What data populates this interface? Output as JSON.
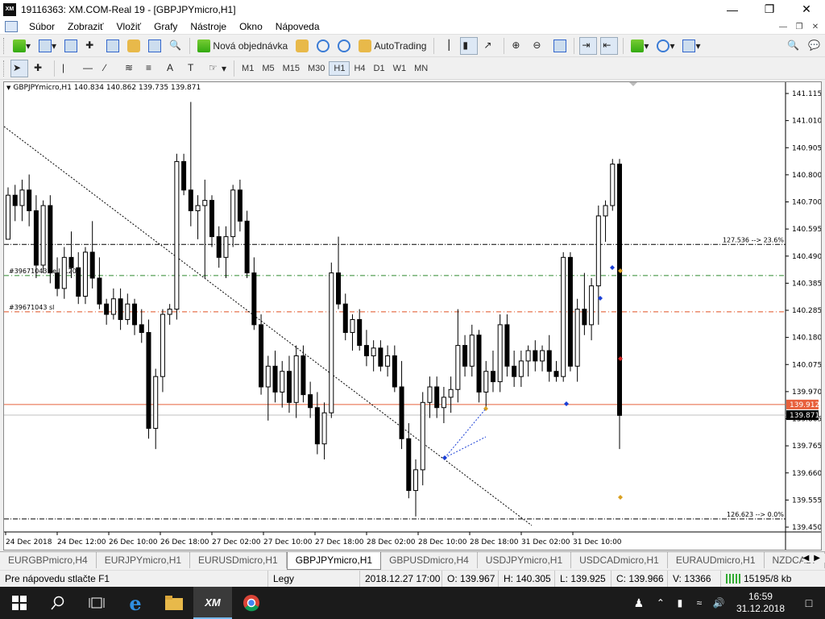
{
  "window": {
    "title": "19116363: XM.COM-Real 19 - [GBPJPYmicro,H1]",
    "app_icon_text": "XM"
  },
  "menu": [
    "Súbor",
    "Zobraziť",
    "Vložiť",
    "Grafy",
    "Nástroje",
    "Okno",
    "Nápoveda"
  ],
  "toolbar1": {
    "new_order": "Nová objednávka",
    "autotrading": "AutoTrading"
  },
  "timeframes": [
    "M1",
    "M5",
    "M15",
    "M30",
    "H1",
    "H4",
    "D1",
    "W1",
    "MN"
  ],
  "active_timeframe": "H1",
  "chart": {
    "header": "GBPJPYmicro,H1  140.834 140.862 139.735 139.871",
    "order_label_sell": "#39671043 sell 0.20",
    "order_label_sl": "#39671043 sl",
    "fib_top": "127.536 --> 23.6%",
    "fib_bottom": "126.623 --> 0.0%",
    "price_label_red": "139.912",
    "price_label_black": "139.871",
    "colors": {
      "bid_line": "#e8603c",
      "sell_line": "#2e8b2e",
      "sl_line": "#e05020",
      "ask_line": "#c0c0c0"
    }
  },
  "chart_data": {
    "type": "candlestick",
    "symbol": "GBPJPYmicro",
    "timeframe": "H1",
    "y_ticks": [
      "141.115",
      "141.010",
      "140.905",
      "140.800",
      "140.700",
      "140.595",
      "140.490",
      "140.385",
      "140.285",
      "140.180",
      "140.075",
      "139.970",
      "139.865",
      "139.765",
      "139.660",
      "139.555",
      "139.450"
    ],
    "x_ticks": [
      "24 Dec 2018",
      "24 Dec 12:00",
      "26 Dec 10:00",
      "26 Dec 18:00",
      "27 Dec 02:00",
      "27 Dec 10:00",
      "27 Dec 18:00",
      "28 Dec 02:00",
      "28 Dec 10:00",
      "28 Dec 18:00",
      "31 Dec 02:00",
      "31 Dec 10:00"
    ],
    "ylim": [
      139.42,
      141.15
    ],
    "levels": {
      "fib_23_6": 140.53,
      "sell_entry": 140.41,
      "stop_loss": 140.27,
      "bid": 139.912,
      "last": 139.871,
      "fib_0": 139.47
    },
    "candles": [
      [
        140.55,
        140.75,
        140.55,
        140.72
      ],
      [
        140.72,
        140.76,
        140.62,
        140.68
      ],
      [
        140.68,
        140.78,
        140.62,
        140.74
      ],
      [
        140.74,
        140.8,
        140.6,
        140.66
      ],
      [
        140.66,
        140.72,
        140.4,
        140.45
      ],
      [
        140.45,
        140.7,
        140.42,
        140.68
      ],
      [
        140.68,
        140.72,
        140.38,
        140.42
      ],
      [
        140.42,
        140.48,
        140.33,
        140.36
      ],
      [
        140.36,
        140.52,
        140.32,
        140.48
      ],
      [
        140.48,
        140.58,
        140.4,
        140.44
      ],
      [
        140.44,
        140.5,
        140.3,
        140.33
      ],
      [
        140.33,
        140.52,
        140.3,
        140.5
      ],
      [
        140.5,
        140.62,
        140.36,
        140.4
      ],
      [
        140.4,
        140.48,
        140.28,
        140.3
      ],
      [
        140.3,
        140.32,
        140.22,
        140.26
      ],
      [
        140.26,
        140.36,
        140.24,
        140.32
      ],
      [
        140.32,
        140.36,
        140.2,
        140.24
      ],
      [
        140.24,
        140.34,
        140.22,
        140.3
      ],
      [
        140.3,
        140.32,
        140.18,
        140.22
      ],
      [
        140.22,
        140.28,
        140.15,
        140.19
      ],
      [
        140.19,
        140.24,
        139.78,
        139.82
      ],
      [
        139.82,
        140.05,
        139.74,
        140.02
      ],
      [
        140.02,
        140.28,
        139.96,
        140.26
      ],
      [
        140.26,
        140.3,
        140.22,
        140.28
      ],
      [
        140.28,
        140.88,
        140.24,
        140.85
      ],
      [
        140.85,
        140.88,
        140.72,
        140.74
      ],
      [
        140.74,
        141.08,
        140.6,
        140.66
      ],
      [
        140.66,
        140.72,
        140.55,
        140.68
      ],
      [
        140.68,
        140.78,
        140.4,
        140.7
      ],
      [
        140.7,
        140.72,
        140.52,
        140.56
      ],
      [
        140.56,
        140.6,
        140.44,
        140.48
      ],
      [
        140.48,
        140.6,
        140.4,
        140.56
      ],
      [
        140.56,
        140.76,
        140.52,
        140.74
      ],
      [
        140.74,
        140.78,
        140.58,
        140.62
      ],
      [
        140.62,
        140.66,
        140.4,
        140.42
      ],
      [
        140.42,
        140.48,
        140.2,
        140.22
      ],
      [
        140.22,
        140.26,
        139.95,
        139.98
      ],
      [
        139.98,
        140.1,
        139.85,
        140.06
      ],
      [
        140.06,
        140.12,
        139.92,
        139.96
      ],
      [
        139.96,
        140.08,
        139.9,
        140.04
      ],
      [
        140.04,
        140.1,
        139.88,
        139.92
      ],
      [
        139.92,
        140.14,
        139.86,
        140.1
      ],
      [
        140.1,
        140.14,
        139.92,
        139.95
      ],
      [
        139.95,
        140.0,
        139.86,
        139.9
      ],
      [
        139.9,
        139.96,
        139.72,
        139.76
      ],
      [
        139.76,
        139.92,
        139.7,
        139.88
      ],
      [
        139.88,
        140.46,
        139.86,
        140.42
      ],
      [
        140.42,
        140.56,
        140.28,
        140.3
      ],
      [
        140.3,
        140.34,
        140.16,
        140.19
      ],
      [
        140.19,
        140.26,
        140.12,
        140.24
      ],
      [
        140.24,
        140.28,
        140.12,
        140.14
      ],
      [
        140.14,
        140.2,
        140.06,
        140.1
      ],
      [
        140.1,
        140.16,
        140.04,
        140.13
      ],
      [
        140.13,
        140.16,
        140.04,
        140.06
      ],
      [
        140.06,
        140.14,
        140.02,
        140.1
      ],
      [
        140.1,
        140.14,
        139.96,
        139.98
      ],
      [
        139.98,
        140.08,
        139.74,
        139.78
      ],
      [
        139.78,
        139.84,
        139.55,
        139.58
      ],
      [
        139.58,
        139.7,
        139.48,
        139.66
      ],
      [
        139.66,
        139.96,
        139.6,
        139.92
      ],
      [
        139.92,
        140.02,
        139.86,
        139.98
      ],
      [
        139.98,
        140.02,
        139.86,
        139.9
      ],
      [
        139.9,
        139.98,
        139.84,
        139.94
      ],
      [
        139.94,
        140.02,
        139.88,
        139.97
      ],
      [
        139.97,
        140.28,
        139.92,
        140.14
      ],
      [
        140.14,
        140.18,
        140.02,
        140.06
      ],
      [
        140.06,
        140.22,
        140.02,
        140.18
      ],
      [
        140.18,
        140.2,
        139.92,
        139.96
      ],
      [
        139.96,
        140.08,
        139.9,
        140.04
      ],
      [
        140.04,
        140.12,
        139.96,
        140.0
      ],
      [
        140.0,
        140.26,
        139.96,
        140.22
      ],
      [
        140.22,
        140.26,
        140.02,
        140.06
      ],
      [
        140.06,
        140.12,
        139.98,
        140.02
      ],
      [
        140.02,
        140.12,
        139.98,
        140.08
      ],
      [
        140.08,
        140.14,
        140.02,
        140.12
      ],
      [
        140.12,
        140.16,
        140.04,
        140.08
      ],
      [
        140.08,
        140.14,
        140.04,
        140.12
      ],
      [
        140.12,
        140.18,
        140.0,
        140.04
      ],
      [
        140.04,
        140.08,
        140.0,
        140.02
      ],
      [
        140.02,
        140.5,
        140.0,
        140.48
      ],
      [
        140.48,
        140.5,
        140.04,
        140.06
      ],
      [
        140.06,
        140.32,
        140.0,
        140.28
      ],
      [
        140.28,
        140.42,
        140.18,
        140.22
      ],
      [
        140.22,
        140.4,
        140.16,
        140.37
      ],
      [
        140.37,
        140.68,
        140.22,
        140.64
      ],
      [
        140.64,
        140.7,
        140.54,
        140.68
      ],
      [
        140.68,
        140.86,
        140.66,
        140.84
      ],
      [
        140.84,
        140.86,
        139.74,
        139.87
      ]
    ]
  },
  "tabs": [
    "EURGBPmicro,H4",
    "EURJPYmicro,H1",
    "EURUSDmicro,H1",
    "GBPJPYmicro,H1",
    "GBPUSDmicro,H4",
    "USDJPYmicro,H1",
    "USDCADmicro,H1",
    "EURAUDmicro,H1",
    "NZDCADr"
  ],
  "active_tab": "GBPJPYmicro,H1",
  "status": {
    "help": "Pre nápovedu stlačte F1",
    "profile": "Legy",
    "datetime": "2018.12.27 17:00",
    "open": "O: 139.967",
    "high": "H: 140.305",
    "low": "L: 139.925",
    "close": "C: 139.966",
    "volume": "V: 13366",
    "traffic": "15195/8 kb"
  },
  "taskbar": {
    "time": "16:59",
    "date": "31.12.2018",
    "xm_label": "XM"
  }
}
